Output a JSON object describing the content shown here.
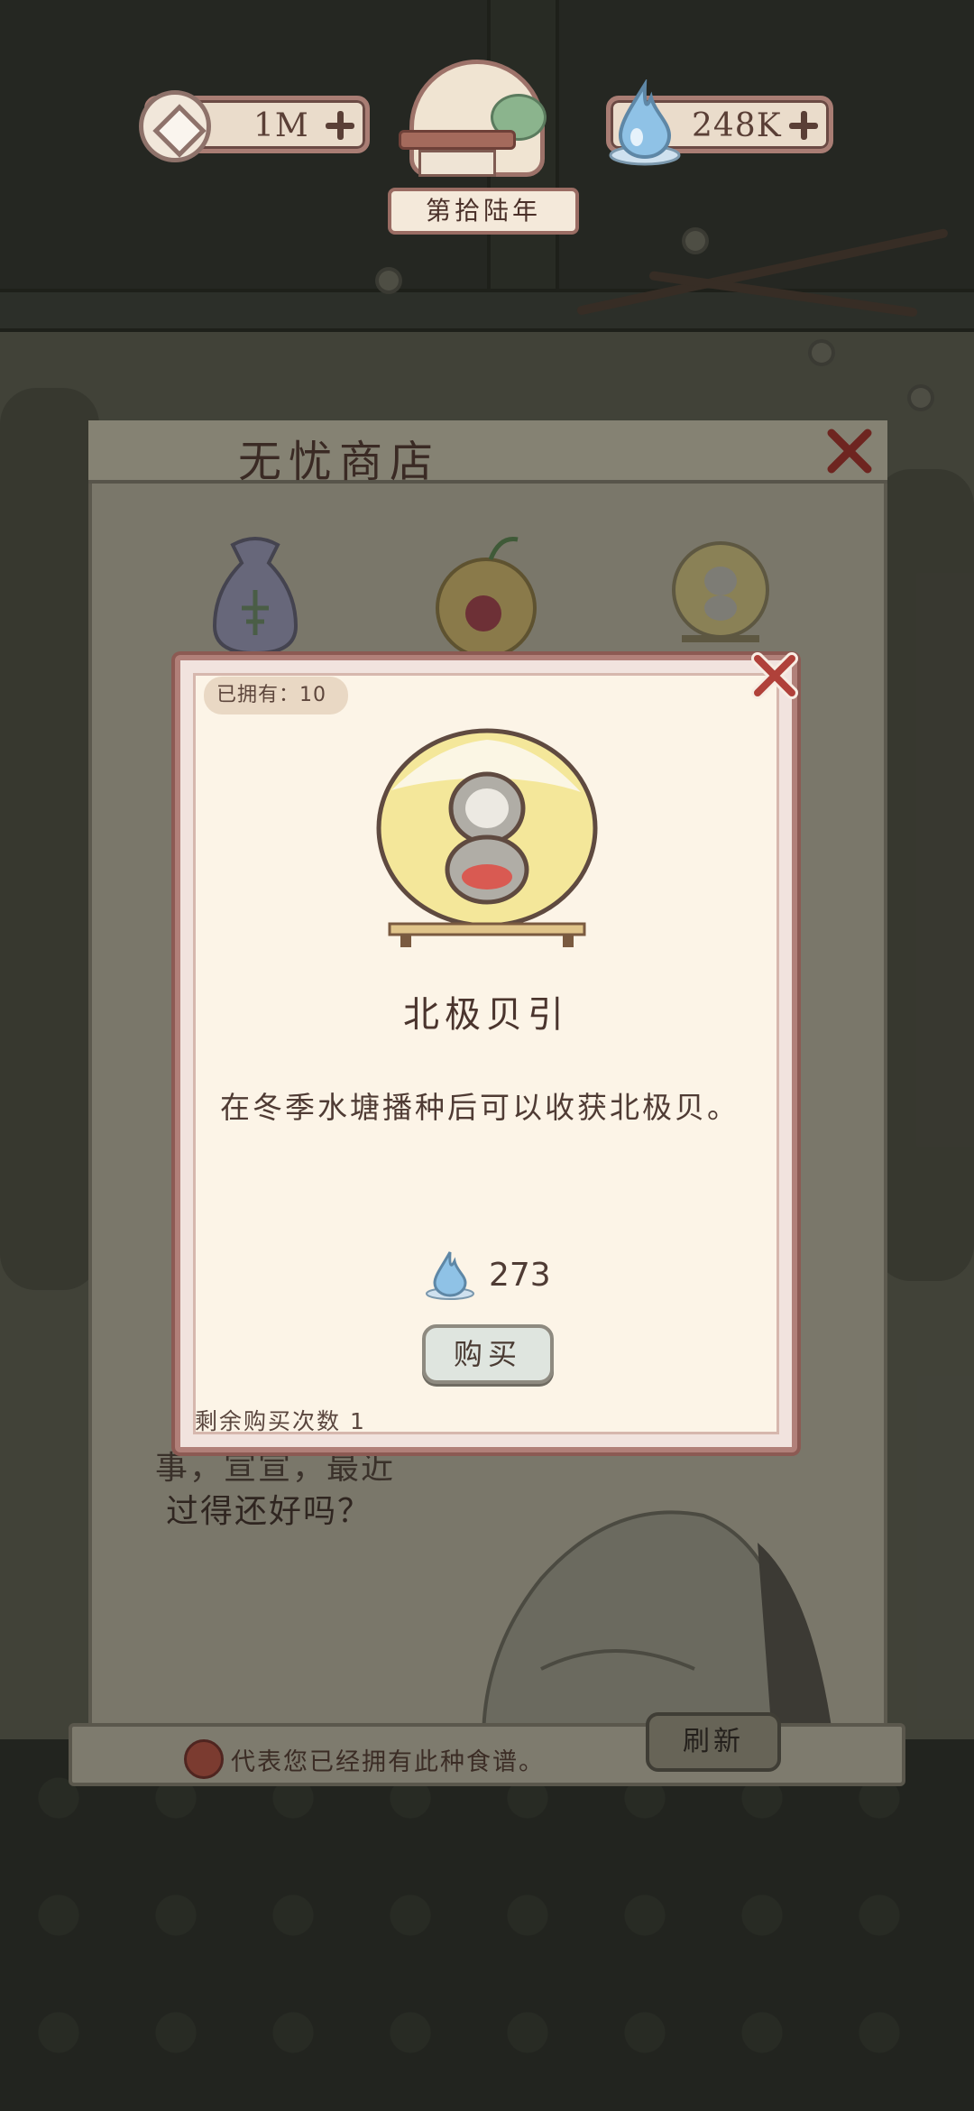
{
  "hud": {
    "coins": "1M",
    "drops": "248K",
    "year": "第拾陆年"
  },
  "shop": {
    "title": "无忧商店",
    "dialog_line1": "事，宣宣，最近",
    "dialog_line2": "过得还好吗？",
    "footer_note": "代表您已经拥有此种食谱。",
    "refresh_label": "刷新"
  },
  "item_modal": {
    "owned": "已拥有：10",
    "name": "北极贝引",
    "description": "在冬季水塘播种后可以收获北极贝。",
    "price": "273",
    "buy_label": "购买",
    "remaining": "剩余购买次数 1"
  },
  "icons": {
    "coin": "coin-icon",
    "drop": "water-drop-icon",
    "close": "close-x-icon",
    "plus": "plus-icon"
  },
  "colors": {
    "accent_red": "#b0413a",
    "modal_bg": "#fcf4e7",
    "modal_border": "#b18079",
    "drop_blue": "#7fb6dd"
  }
}
